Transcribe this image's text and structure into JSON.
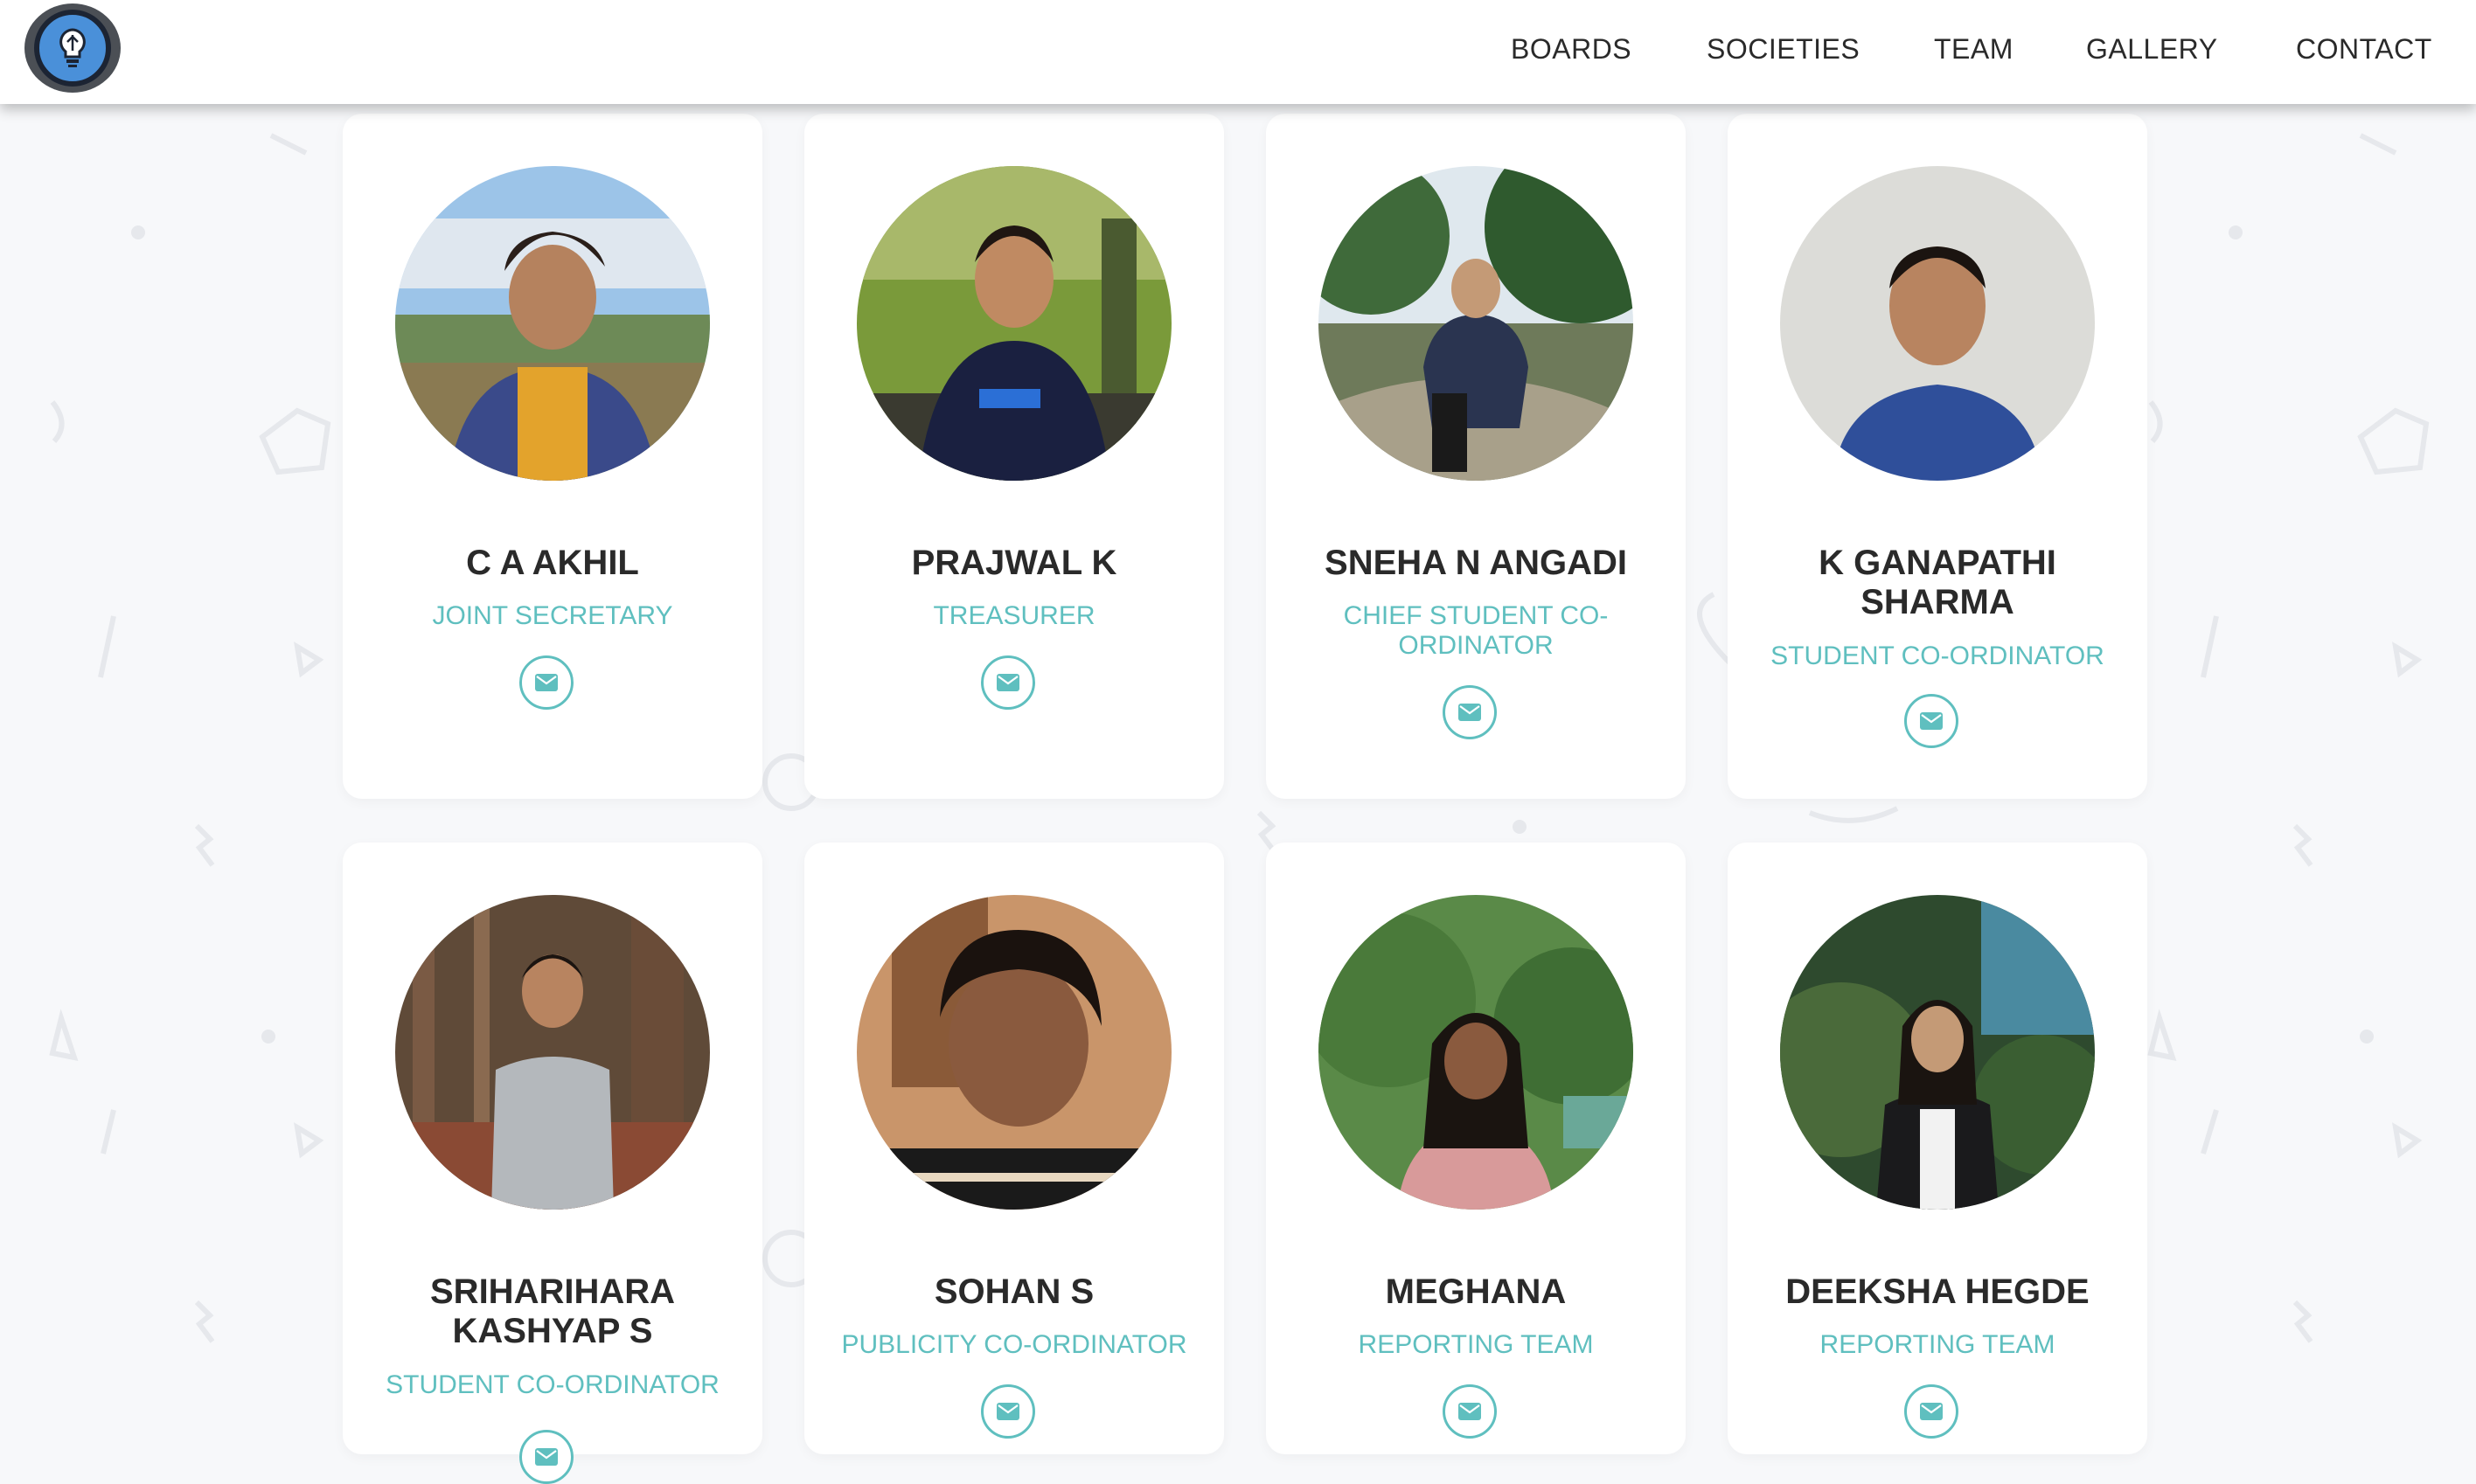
{
  "nav": {
    "logo_alt": "Logo",
    "links": [
      "BOARDS",
      "SOCIETIES",
      "TEAM",
      "GALLERY",
      "CONTACT"
    ]
  },
  "colors": {
    "accent": "#5fbfbf",
    "name_text": "#2a2a2a",
    "card_bg": "#ffffff",
    "page_bg": "#f7f8fa"
  },
  "members": [
    {
      "name": "C A AKHIL",
      "role": "JOINT SECRETARY",
      "icon": "envelope-icon"
    },
    {
      "name": "PRAJWAL K",
      "role": "TREASURER",
      "icon": "envelope-icon"
    },
    {
      "name": "SNEHA N ANGADI",
      "role": "CHIEF STUDENT CO-ORDINATOR",
      "icon": "envelope-icon"
    },
    {
      "name": "K GANAPATHI SHARMA",
      "role": "STUDENT CO-ORDINATOR",
      "icon": "envelope-icon"
    },
    {
      "name": "SRIHARIHARA KASHYAP S",
      "role": "STUDENT CO-ORDINATOR",
      "icon": "envelope-icon"
    },
    {
      "name": "SOHAN S",
      "role": "PUBLICITY CO-ORDINATOR",
      "icon": "envelope-icon"
    },
    {
      "name": "MEGHANA",
      "role": "REPORTING TEAM",
      "icon": "envelope-icon"
    },
    {
      "name": "DEEKSHA HEGDE",
      "role": "REPORTING TEAM",
      "icon": "envelope-icon"
    }
  ]
}
